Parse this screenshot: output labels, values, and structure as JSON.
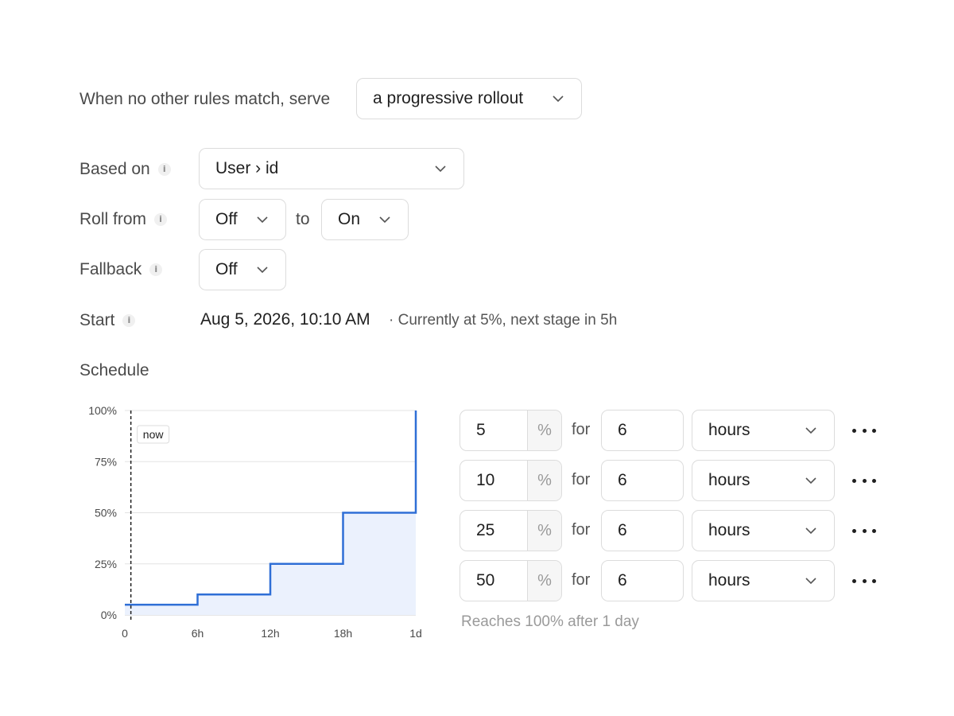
{
  "default_rule": {
    "prefix": "When no other rules match, serve",
    "value": "a progressive rollout"
  },
  "based_on": {
    "label": "Based on",
    "value": "User › id"
  },
  "roll_from": {
    "label": "Roll from",
    "from": "Off",
    "to_label": "to",
    "to": "On"
  },
  "fallback": {
    "label": "Fallback",
    "value": "Off"
  },
  "start": {
    "label": "Start",
    "value": "Aug 5, 2026, 10:10 AM",
    "status": "· Currently at 5%, next stage in 5h"
  },
  "schedule": {
    "label": "Schedule",
    "stages": [
      {
        "percent": "5",
        "unit": "%",
        "for_label": "for",
        "duration": "6",
        "duration_unit": "hours"
      },
      {
        "percent": "10",
        "unit": "%",
        "for_label": "for",
        "duration": "6",
        "duration_unit": "hours"
      },
      {
        "percent": "25",
        "unit": "%",
        "for_label": "for",
        "duration": "6",
        "duration_unit": "hours"
      },
      {
        "percent": "50",
        "unit": "%",
        "for_label": "for",
        "duration": "6",
        "duration_unit": "hours"
      }
    ],
    "summary": "Reaches 100% after 1 day"
  },
  "chart_data": {
    "type": "line",
    "step": true,
    "x": [
      0,
      6,
      12,
      18,
      24
    ],
    "x_tick_labels": [
      "0",
      "6h",
      "12h",
      "18h",
      "1d"
    ],
    "y_tick_labels": [
      "0%",
      "25%",
      "50%",
      "75%",
      "100%"
    ],
    "ylim": [
      0,
      100
    ],
    "series": [
      {
        "values": [
          5,
          10,
          25,
          50,
          100
        ]
      }
    ],
    "now_label": "now",
    "now_x": 0.5,
    "grid": true,
    "line_color": "#2f6fd6",
    "fill_color": "#ebf1fd"
  },
  "icons": {
    "chevron": "chevron-down-icon",
    "info": "info-icon",
    "more": "more-horizontal-icon"
  },
  "info_glyph": "i"
}
